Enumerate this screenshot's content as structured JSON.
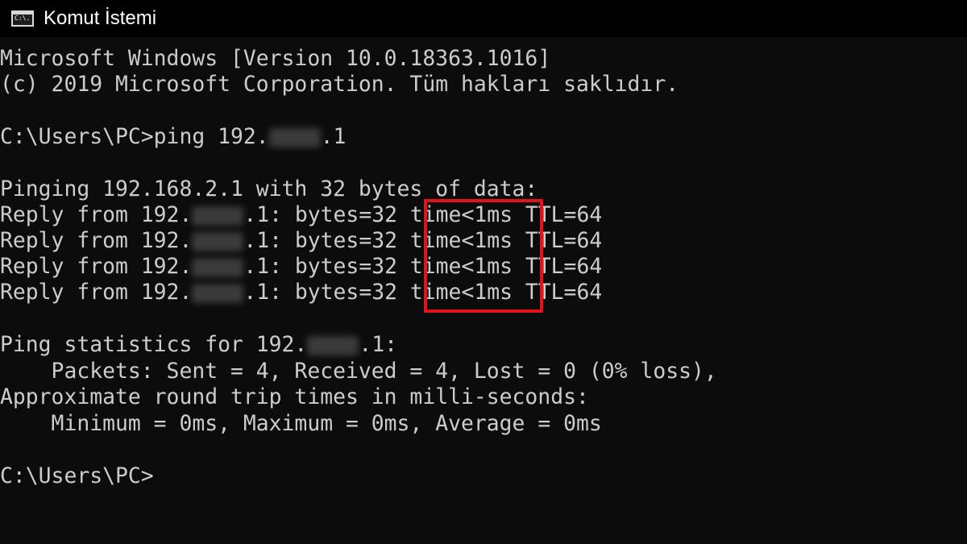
{
  "window": {
    "title": "Komut İstemi",
    "icon": "cmd-icon",
    "icon_text": "C:\\."
  },
  "console": {
    "header1": "Microsoft Windows [Version 10.0.18363.1016]",
    "header2": "(c) 2019 Microsoft Corporation. Tüm hakları saklıdır.",
    "prompt": "C:\\Users\\PC>",
    "command_prefix": "ping 192.",
    "command_suffix": ".1",
    "pinging_line": "Pinging 192.168.2.1 with 32 bytes of data:",
    "replies": [
      {
        "prefix": "Reply from 192.",
        "suffix": ".1: bytes=32 ",
        "time": "time<1ms",
        "ttl": " TTL=64"
      },
      {
        "prefix": "Reply from 192.",
        "suffix": ".1: bytes=32 ",
        "time": "time<1ms",
        "ttl": " TTL=64"
      },
      {
        "prefix": "Reply from 192.",
        "suffix": ".1: bytes=32 ",
        "time": "time<1ms",
        "ttl": " TTL=64"
      },
      {
        "prefix": "Reply from 192.",
        "suffix": ".1: bytes=32 ",
        "time": "time<1ms",
        "ttl": " TTL=64"
      }
    ],
    "stats_prefix": "Ping statistics for 192.",
    "stats_suffix": ".1:",
    "packets_line": "    Packets: Sent = 4, Received = 4, Lost = 0 (0% loss),",
    "approx_line": "Approximate round trip times in milli-seconds:",
    "times_line": "    Minimum = 0ms, Maximum = 0ms, Average = 0ms",
    "final_prompt": "C:\\Users\\PC>"
  },
  "colors": {
    "background": "#0c0c0c",
    "text": "#cccccc",
    "highlight": "#e0141b"
  }
}
